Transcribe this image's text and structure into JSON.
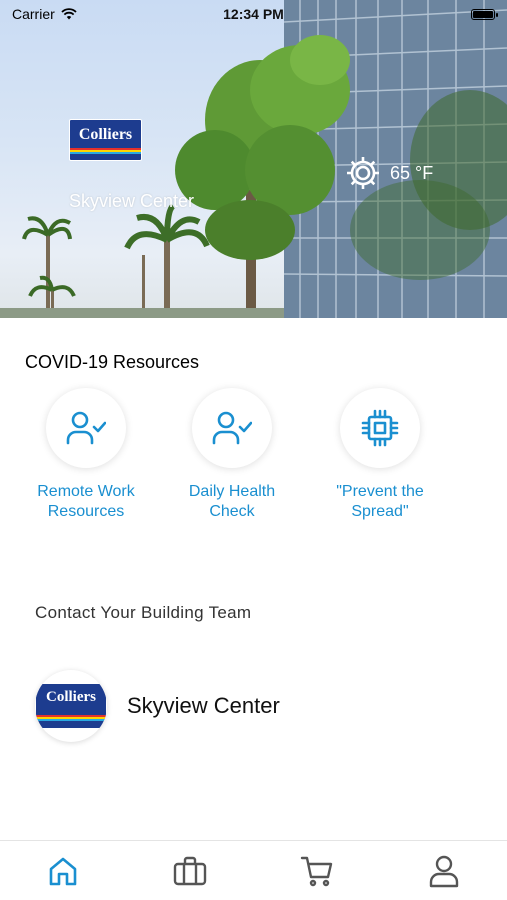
{
  "status_bar": {
    "carrier": "Carrier",
    "time": "12:34 PM"
  },
  "hero": {
    "logo_text": "Colliers",
    "building_name": "Skyview Center",
    "temperature": "65 °F",
    "weather_icon": "gear-sun-icon"
  },
  "covid": {
    "title": "COVID-19 Resources",
    "items": [
      {
        "label": "Remote Work\nResources",
        "icon": "person-check-icon"
      },
      {
        "label": "Daily Health\nCheck",
        "icon": "person-check-icon"
      },
      {
        "label": "\"Prevent the\nSpread\"",
        "icon": "chip-icon"
      }
    ]
  },
  "contact": {
    "title": "Contact Your Building Team",
    "logo_text": "Colliers",
    "name": "Skyview Center"
  },
  "tab_bar": {
    "items": [
      {
        "icon": "home-icon",
        "active": true
      },
      {
        "icon": "briefcase-icon",
        "active": false
      },
      {
        "icon": "cart-icon",
        "active": false
      },
      {
        "icon": "profile-icon",
        "active": false
      }
    ]
  },
  "colors": {
    "accent": "#1a8fd0",
    "brand_navy": "#1d3c8f",
    "icon_gray": "#555555"
  }
}
